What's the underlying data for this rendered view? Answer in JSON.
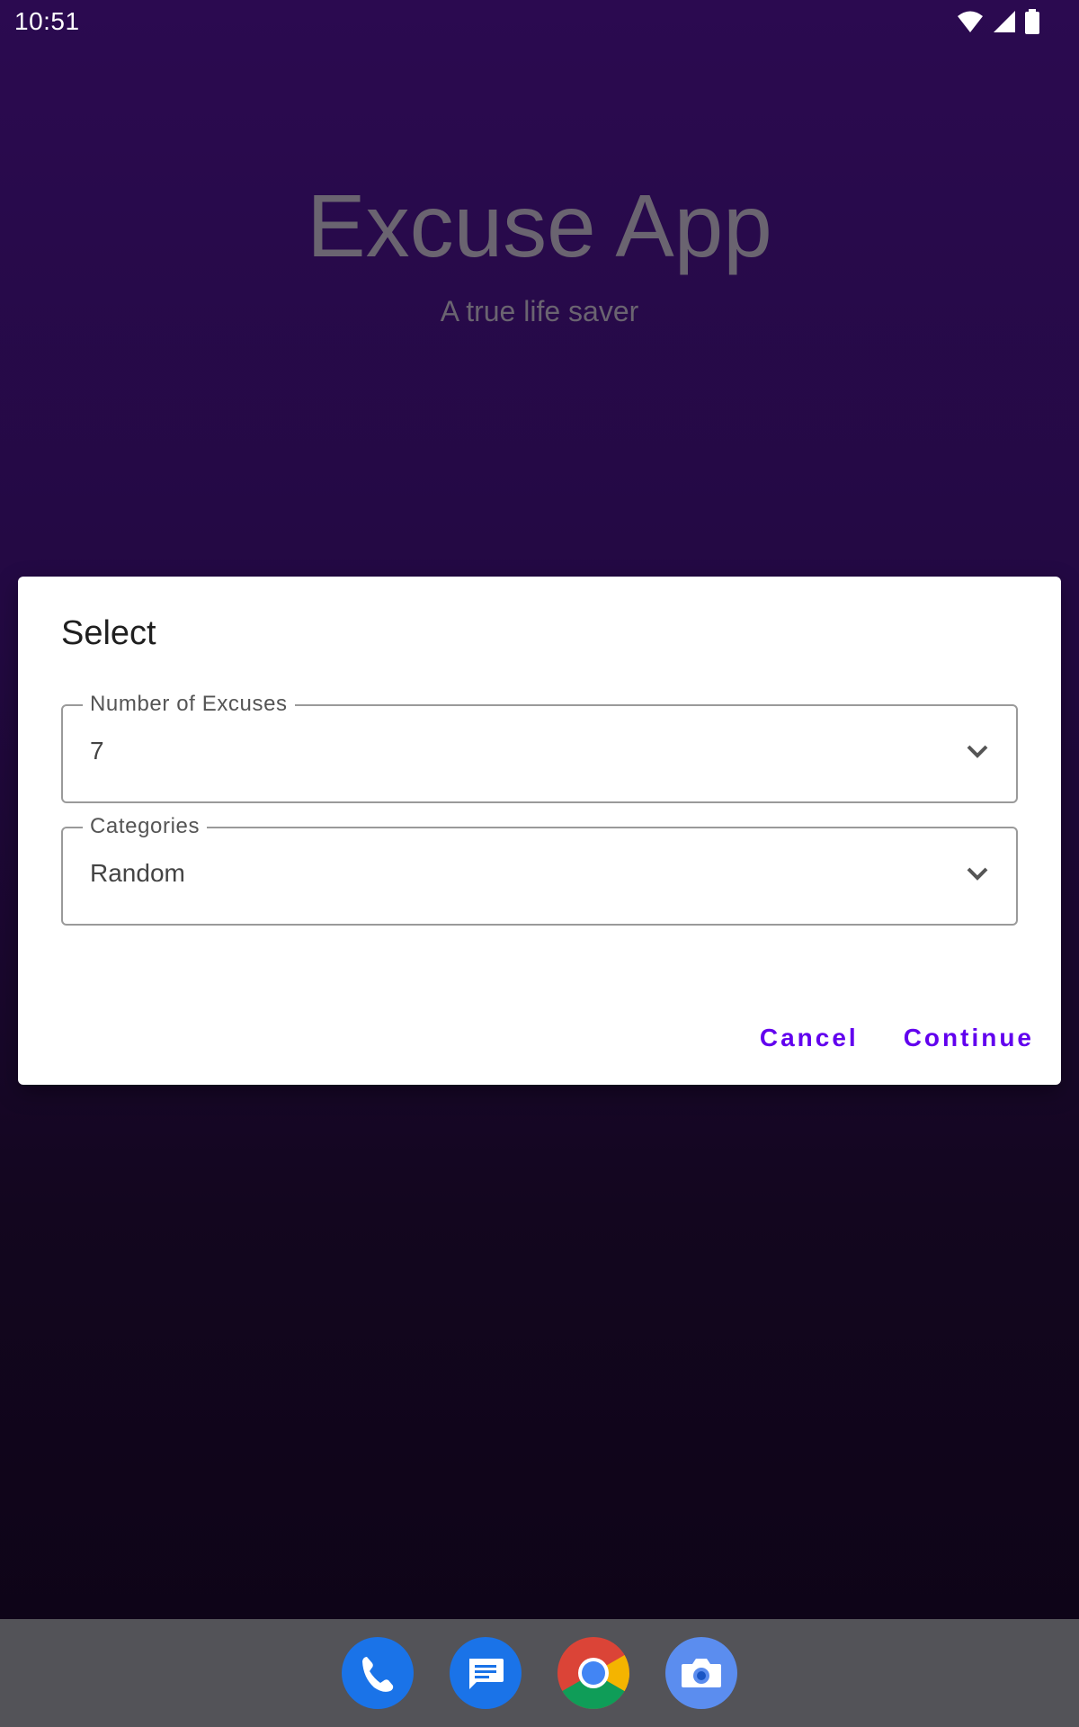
{
  "status_bar": {
    "time": "10:51",
    "icons": [
      "wifi-icon",
      "cellular-signal-icon",
      "battery-icon"
    ]
  },
  "app": {
    "title": "Excuse App",
    "subtitle": "A true life saver"
  },
  "dialog": {
    "title": "Select",
    "fields": [
      {
        "label": "Number of Excuses",
        "value": "7"
      },
      {
        "label": "Categories",
        "value": "Random"
      }
    ],
    "cancel_label": "Cancel",
    "continue_label": "Continue"
  },
  "dock": {
    "apps": [
      "phone-icon",
      "messages-icon",
      "chrome-icon",
      "camera-icon"
    ]
  },
  "colors": {
    "accent": "#6200ee",
    "background_top": "#2b0a50",
    "background_bottom": "#0d0416",
    "dock": "#535358"
  }
}
